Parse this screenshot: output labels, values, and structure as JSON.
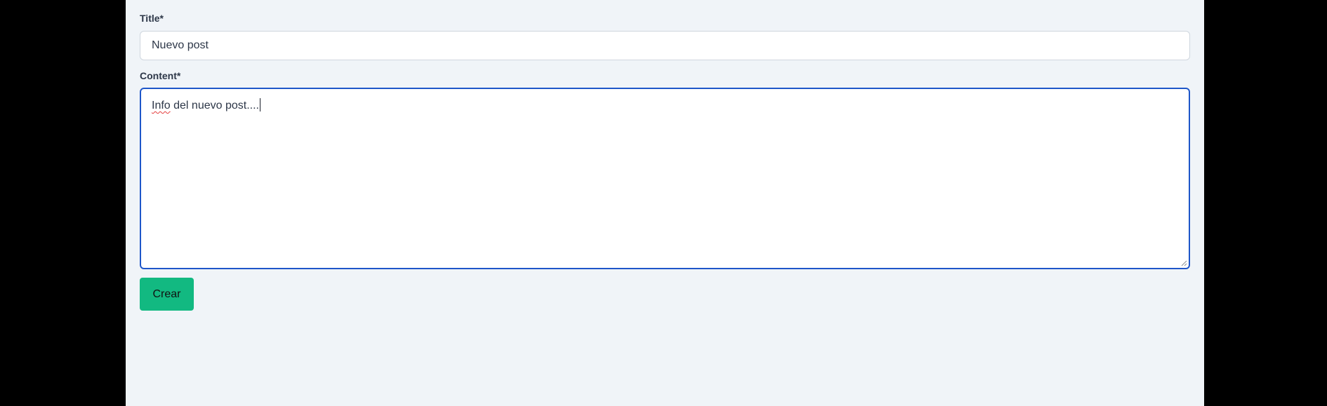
{
  "form": {
    "title_label": "Title*",
    "title_value": "Nuevo post",
    "content_label": "Content*",
    "content_first_word": "Info",
    "content_rest": " del nuevo post....",
    "submit_label": "Crear"
  },
  "colors": {
    "page_background": "#f0f4f8",
    "side_background": "#000000",
    "focus_border": "#1e56c9",
    "submit_button": "#12b981",
    "spellcheck_underline": "#e53e3e"
  },
  "icons": {
    "resize_handle": "resize-handle-icon"
  }
}
